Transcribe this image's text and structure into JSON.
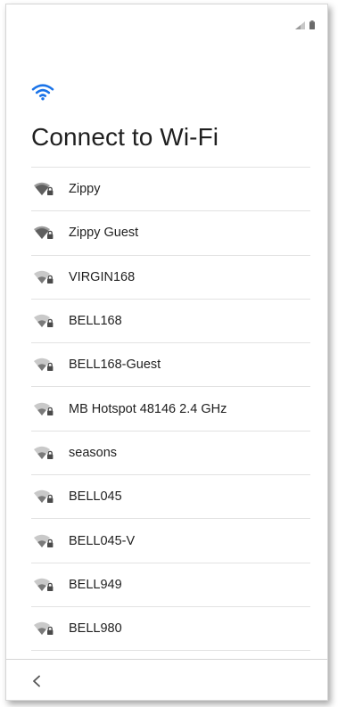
{
  "screen": {
    "title": "Connect to Wi-Fi",
    "accent_color": "#1a73e8",
    "header_icon": "wifi-icon"
  },
  "status_bar": {
    "icons": [
      "signal-icon",
      "battery-icon"
    ]
  },
  "networks": [
    {
      "ssid": "Zippy",
      "icon": "wifi-lock-icon",
      "signal": "strong"
    },
    {
      "ssid": "Zippy Guest",
      "icon": "wifi-lock-icon",
      "signal": "strong"
    },
    {
      "ssid": "VIRGIN168",
      "icon": "wifi-lock-icon",
      "signal": "medium"
    },
    {
      "ssid": "BELL168",
      "icon": "wifi-lock-icon",
      "signal": "medium"
    },
    {
      "ssid": "BELL168-Guest",
      "icon": "wifi-lock-icon",
      "signal": "medium"
    },
    {
      "ssid": "MB Hotspot 48146 2.4 GHz",
      "icon": "wifi-lock-icon",
      "signal": "medium"
    },
    {
      "ssid": "seasons",
      "icon": "wifi-lock-icon",
      "signal": "medium"
    },
    {
      "ssid": "BELL045",
      "icon": "wifi-lock-icon",
      "signal": "medium"
    },
    {
      "ssid": "BELL045-V",
      "icon": "wifi-lock-icon",
      "signal": "medium"
    },
    {
      "ssid": "BELL949",
      "icon": "wifi-lock-icon",
      "signal": "medium"
    },
    {
      "ssid": "BELL980",
      "icon": "wifi-lock-icon",
      "signal": "medium"
    }
  ],
  "navigation": {
    "back_icon": "chevron-left-icon"
  }
}
